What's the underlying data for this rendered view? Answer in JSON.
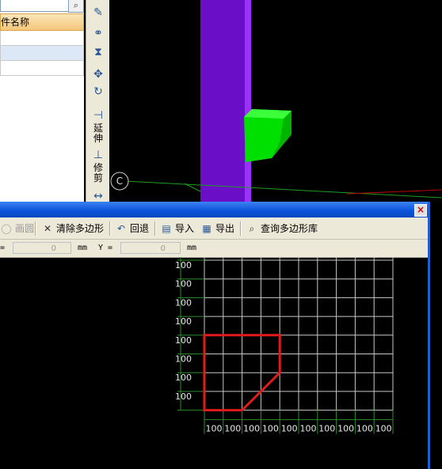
{
  "left_panel": {
    "search_icon": "search-icon",
    "column_header": "构件名称"
  },
  "vtoolbar": {
    "extend_label_1": "延",
    "extend_label_2": "伸",
    "trim_label_1": "修",
    "trim_label_2": "剪"
  },
  "viewport": {
    "axis_label": "C"
  },
  "dialog": {
    "close_label": "×",
    "toolbar": {
      "draw_arc": "画圆",
      "clear_polygon": "清除多边形",
      "undo": "回退",
      "import": "导入",
      "export": "导出",
      "query_library": "查询多边形库"
    },
    "coords": {
      "x_value": "0",
      "x_unit": "mm",
      "y_label": "Y =",
      "y_value": "0",
      "y_unit": "mm",
      "x_label_fragment": "="
    },
    "grid": {
      "cell_label": "100",
      "rows": 8,
      "cols": 10,
      "polygon_color": "#e01b1b",
      "grid_color": "#c8c8c8",
      "axis_color": "#2e8b2e"
    }
  },
  "colors": {
    "purple_column": "#6a0fc7",
    "green_block": "#00e000",
    "title_blue": "#0a53d8"
  }
}
